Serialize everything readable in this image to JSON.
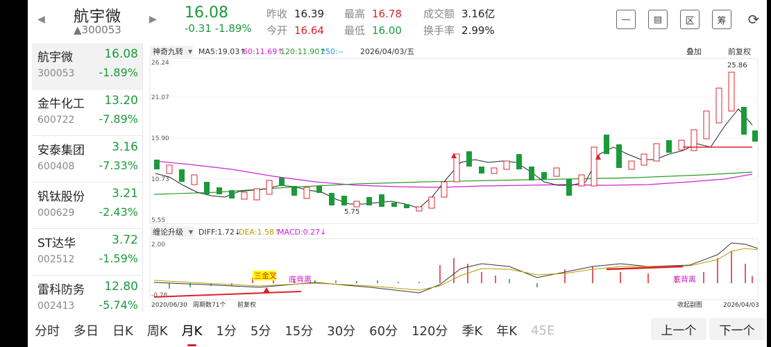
{
  "header": {
    "name": "航宇微",
    "code": "▲300053",
    "price": "16.08",
    "change": "-0.31  -1.89%",
    "prev_close_label": "昨收",
    "prev_close": "16.39",
    "open_label": "今开",
    "open": "16.64",
    "high_label": "最高",
    "high": "16.78",
    "low_label": "最低",
    "low": "16.00",
    "turnover_label": "成交额",
    "turnover": "3.16亿",
    "rate_label": "换手率",
    "rate": "2.99%",
    "icons": [
      "minus-icon",
      "screen-icon",
      "region-icon",
      "chip-icon",
      "rotate-icon"
    ],
    "icon_glyphs": [
      "—",
      "▤",
      "区",
      "筹",
      "⟳"
    ]
  },
  "sidebar": {
    "items": [
      {
        "name": "航宇微",
        "code": "300053",
        "price": "16.08",
        "change": "-1.89%"
      },
      {
        "name": "金牛化工",
        "code": "600722",
        "price": "13.20",
        "change": "-7.89%"
      },
      {
        "name": "安泰集团",
        "code": "600408",
        "price": "3.16",
        "change": "-7.33%"
      },
      {
        "name": "钒钛股份",
        "code": "000629",
        "price": "3.21",
        "change": "-2.43%"
      },
      {
        "name": "ST达华",
        "code": "002512",
        "price": "3.72",
        "change": "-1.59%"
      },
      {
        "name": "雷科防务",
        "code": "002413",
        "price": "12.80",
        "change": "-5.74%"
      }
    ]
  },
  "chart": {
    "indicator": "神奇九转",
    "ma5": "MA5:19.03↑",
    "ma60": "60:11.69↑",
    "ma120": "120:11.90↑",
    "ma250": "250:--",
    "date": "2026/04/03/五",
    "overlay": "叠加",
    "adjust": "前复权",
    "y_ticks": [
      "26.24",
      "21.07",
      "15.90",
      "10.73",
      "5.55"
    ],
    "high_label": "25.86",
    "low_label": "5.75",
    "sub_indicator": "缠论升级",
    "diff": "DIFF:1.72↓",
    "dea": "DEA:1.58↑",
    "macd": "MACD:0.27↓",
    "sub_y_ticks": [
      "2.00",
      "-0.78"
    ],
    "signal1": "三金叉",
    "signal2": "底背离",
    "signal3": "底背离",
    "start_date": "2020/06/30",
    "period_count": "周期数71个",
    "adjust_small": "前复权",
    "collapse": "收起副图",
    "end_date": "2026/04/03",
    "colors": {
      "up": "#e0202a",
      "down": "#1a9a3a",
      "ma5": "#222222",
      "ma60": "#cc22cc",
      "ma120": "#2a9a2a"
    }
  },
  "tabs": [
    "分时",
    "多日",
    "日K",
    "周K",
    "月K",
    "1分",
    "5分",
    "15分",
    "30分",
    "60分",
    "120分",
    "季K",
    "年K",
    "45E"
  ],
  "active_tab": "月K",
  "prev_button": "上一个",
  "next_button": "下一个"
}
